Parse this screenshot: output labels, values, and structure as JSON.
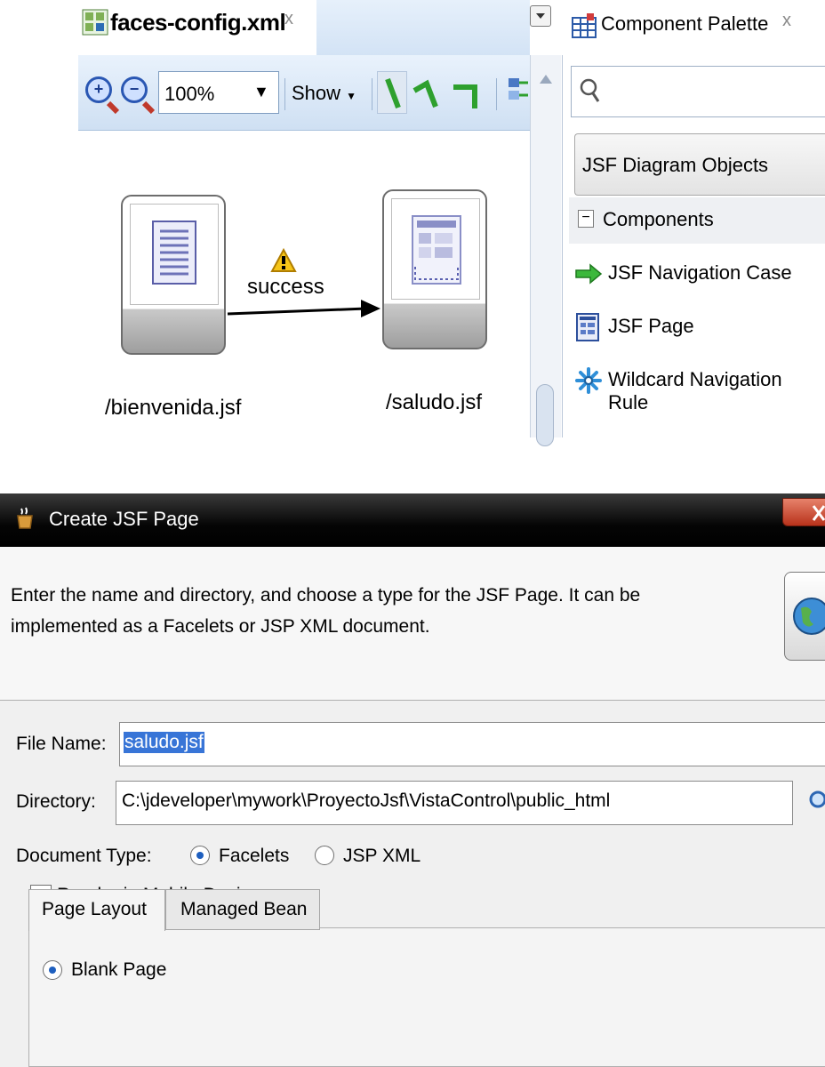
{
  "editor": {
    "tab_label": "faces-config.xml",
    "tab_close": "x",
    "toolbar": {
      "zoom_value": "100%",
      "show_label": "Show"
    },
    "diagram": {
      "nodes": [
        {
          "label": "/bienvenida.jsf"
        },
        {
          "label": "/saludo.jsf"
        }
      ],
      "edge_label": "success"
    }
  },
  "palette": {
    "tab_label": "Component Palette",
    "tab_close": "x",
    "search_placeholder": "",
    "category": "JSF Diagram Objects",
    "section_label": "Components",
    "section_toggle": "−",
    "items": [
      {
        "label": "JSF Navigation Case",
        "icon": "green-arrow-icon"
      },
      {
        "label": "JSF Page",
        "icon": "jsf-page-icon"
      },
      {
        "label": "Wildcard Navigation Rule",
        "icon": "wildcard-icon"
      }
    ]
  },
  "dialog": {
    "title": "Create JSF Page",
    "description": "Enter the name and directory, and choose a type for the JSF Page. It can be implemented as a Facelets or JSP XML document.",
    "file_name_label": "File Name:",
    "file_name_value": "saludo.jsf",
    "directory_label": "Directory:",
    "directory_value": "C:\\jdeveloper\\mywork\\ProyectoJsf\\VistaControl\\public_html",
    "document_type_label": "Document Type:",
    "document_types": [
      {
        "label": "Facelets",
        "selected": true
      },
      {
        "label": "JSP XML",
        "selected": false
      }
    ],
    "render_mobile_label": "Render in Mobile Device",
    "render_mobile_checked": false,
    "tabs": [
      {
        "label": "Page Layout",
        "active": true
      },
      {
        "label": "Managed Bean",
        "active": false
      }
    ],
    "layout_option": "Blank Page"
  },
  "colors": {
    "toolbar_blue": "#d3e3f5",
    "title_bar": "#000000",
    "selection": "#3875d7"
  }
}
